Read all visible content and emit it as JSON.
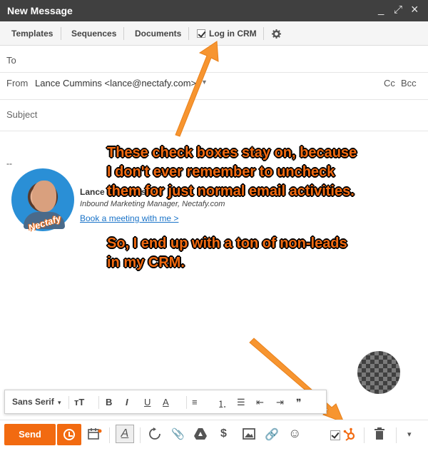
{
  "window": {
    "title": "New Message",
    "minimize_glyph": "_",
    "expand_glyph": "⤢",
    "close_glyph": "×"
  },
  "hs_toolbar": {
    "templates": "Templates",
    "sequences": "Sequences",
    "documents": "Documents",
    "log_in_crm": "Log in CRM",
    "log_in_crm_checked": true,
    "settings_icon": "gear-icon"
  },
  "fields": {
    "to_label": "To",
    "from_label": "From",
    "from_value": "Lance Cummins <lance@nectafy.com>",
    "cc": "Cc",
    "bcc": "Bcc",
    "subject_placeholder": "Subject"
  },
  "signature": {
    "dashes": "--",
    "name": "Lance Cummins",
    "role": "Inbound Marketing Manager, Nectafy.com",
    "link": "Book a meeting with me >",
    "logo_text": "Nectafy"
  },
  "annotation": {
    "line1": "These check boxes stay on, because",
    "line2": "I don't ever remember to uncheck",
    "line3": "them for just normal email activities.",
    "line4": "So, I end up with a ton of non-leads",
    "line5": "in my CRM.",
    "color": "#f26a10"
  },
  "format_bar": {
    "font": "Sans Serif",
    "font_caret": "▾",
    "size": "тT",
    "bold": "B",
    "italic": "I",
    "underline": "U",
    "text_color": "A",
    "align": "≡",
    "numbered_list": "⒈",
    "bullet_list": "☰",
    "indent_less": "⇤",
    "indent_more": "⇥",
    "quote": "❞"
  },
  "bottom_bar": {
    "send": "Send",
    "send_color": "#f26a10",
    "format_toggle": "A",
    "attach": "📎",
    "money": "$",
    "link": "🔗",
    "emoji": "☺",
    "more": "▾"
  }
}
